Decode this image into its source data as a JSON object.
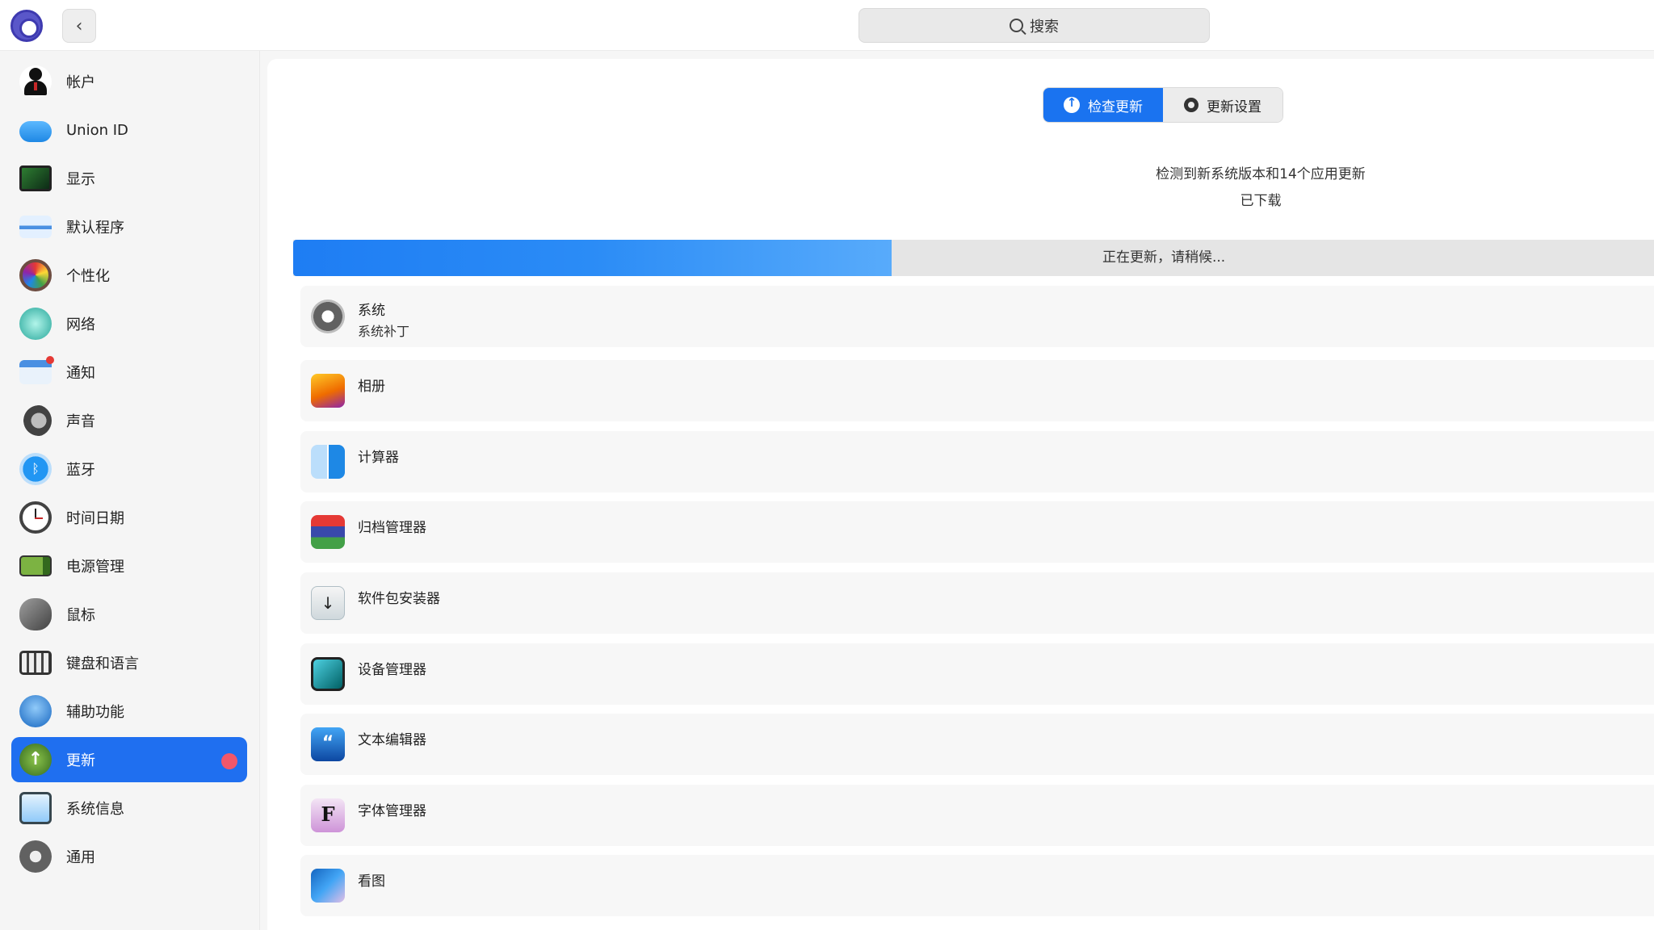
{
  "header": {
    "search_placeholder": "搜索"
  },
  "sidebar": {
    "items": [
      {
        "label": "帐户",
        "icon": "account-icon"
      },
      {
        "label": "Union ID",
        "icon": "cloud-icon"
      },
      {
        "label": "显示",
        "icon": "display-icon"
      },
      {
        "label": "默认程序",
        "icon": "default-apps-icon"
      },
      {
        "label": "个性化",
        "icon": "palette-icon"
      },
      {
        "label": "网络",
        "icon": "network-icon"
      },
      {
        "label": "通知",
        "icon": "notification-icon"
      },
      {
        "label": "声音",
        "icon": "speaker-icon"
      },
      {
        "label": "蓝牙",
        "icon": "bluetooth-icon"
      },
      {
        "label": "时间日期",
        "icon": "clock-icon"
      },
      {
        "label": "电源管理",
        "icon": "battery-icon"
      },
      {
        "label": "鼠标",
        "icon": "mouse-icon"
      },
      {
        "label": "键盘和语言",
        "icon": "keyboard-icon"
      },
      {
        "label": "辅助功能",
        "icon": "accessibility-icon"
      },
      {
        "label": "更新",
        "icon": "update-icon",
        "active": true
      },
      {
        "label": "系统信息",
        "icon": "system-info-icon"
      },
      {
        "label": "通用",
        "icon": "general-icon"
      }
    ]
  },
  "main": {
    "check_update_label": "检查更新",
    "update_settings_label": "更新设置",
    "status_line1": "检测到新系统版本和14个应用更新",
    "status_line2": "已下载",
    "progress_text": "正在更新，请稍候...",
    "progress_fraction": 0.44,
    "updates": [
      {
        "title": "系统",
        "subtitle": "系统补丁",
        "icon": "system-gear-icon"
      },
      {
        "title": "相册",
        "icon": "album-icon"
      },
      {
        "title": "计算器",
        "icon": "calculator-icon"
      },
      {
        "title": "归档管理器",
        "icon": "archive-icon"
      },
      {
        "title": "软件包安装器",
        "icon": "package-installer-icon"
      },
      {
        "title": "设备管理器",
        "icon": "device-manager-icon"
      },
      {
        "title": "文本编辑器",
        "icon": "text-editor-icon"
      },
      {
        "title": "字体管理器",
        "icon": "font-manager-icon"
      },
      {
        "title": "看图",
        "icon": "image-viewer-icon"
      }
    ]
  },
  "colors": {
    "accent": "#1a73f0",
    "badge": "#f2576a"
  }
}
